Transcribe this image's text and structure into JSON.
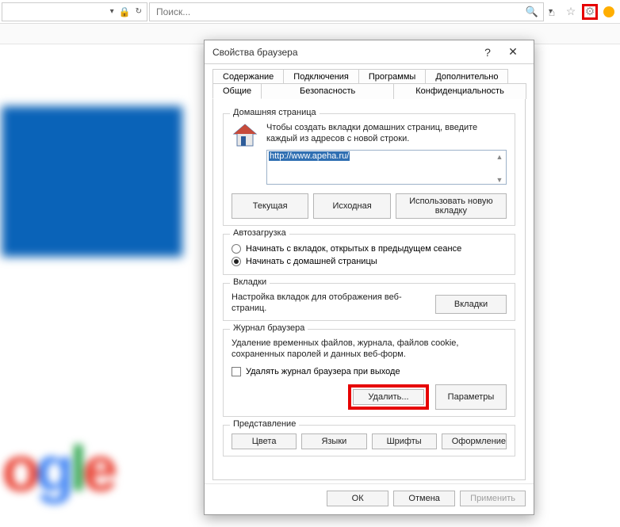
{
  "browser": {
    "search_placeholder": "Поиск..."
  },
  "dialog": {
    "title": "Свойства браузера",
    "help": "?",
    "close": "✕",
    "tabs_row1": {
      "t0": "Содержание",
      "t1": "Подключения",
      "t2": "Программы",
      "t3": "Дополнительно"
    },
    "tabs_row2": {
      "t0": "Общие",
      "t1": "Безопасность",
      "t2": "Конфиденциальность"
    },
    "homepage": {
      "group": "Домашняя страница",
      "desc": "Чтобы создать вкладки домашних страниц, введите каждый из адресов с новой строки.",
      "value": "http://www.apeha.ru/",
      "btn_current": "Текущая",
      "btn_default": "Исходная",
      "btn_newtab": "Использовать новую вкладку"
    },
    "startup": {
      "group": "Автозагрузка",
      "opt_tabs": "Начинать с вкладок, открытых в предыдущем сеансе",
      "opt_home": "Начинать с домашней страницы"
    },
    "tabs": {
      "group": "Вкладки",
      "desc": "Настройка вкладок для отображения веб-страниц.",
      "btn": "Вкладки"
    },
    "history": {
      "group": "Журнал браузера",
      "desc": "Удаление временных файлов, журнала, файлов cookie, сохраненных паролей и данных веб-форм.",
      "chk": "Удалять журнал браузера при выходе",
      "btn_delete": "Удалить...",
      "btn_params": "Параметры"
    },
    "presentation": {
      "group": "Представление",
      "btn_colors": "Цвета",
      "btn_lang": "Языки",
      "btn_fonts": "Шрифты",
      "btn_style": "Оформление"
    },
    "footer": {
      "ok": "ОК",
      "cancel": "Отмена",
      "apply": "Применить"
    }
  }
}
